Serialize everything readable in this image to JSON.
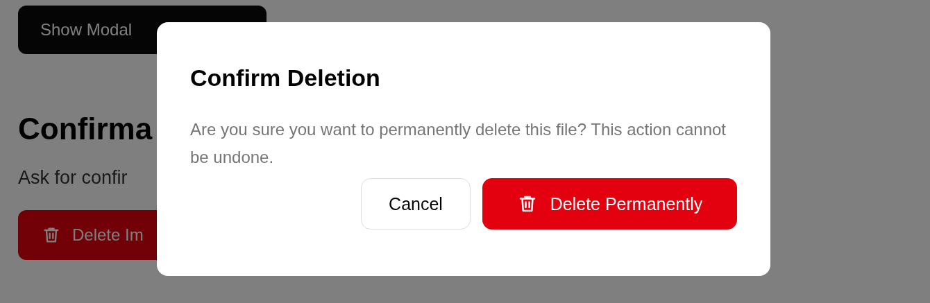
{
  "page": {
    "show_button": "Show Modal",
    "heading": "Confirma",
    "description": "Ask for confir",
    "delete_button": "Delete Im"
  },
  "modal": {
    "title": "Confirm Deletion",
    "message": "Are you sure you want to permanently delete this file? This action cannot be undone.",
    "buttons": [
      {
        "label": "Cancel",
        "kind": "secondary"
      },
      {
        "label": "Delete Permanently",
        "kind": "danger"
      }
    ]
  }
}
